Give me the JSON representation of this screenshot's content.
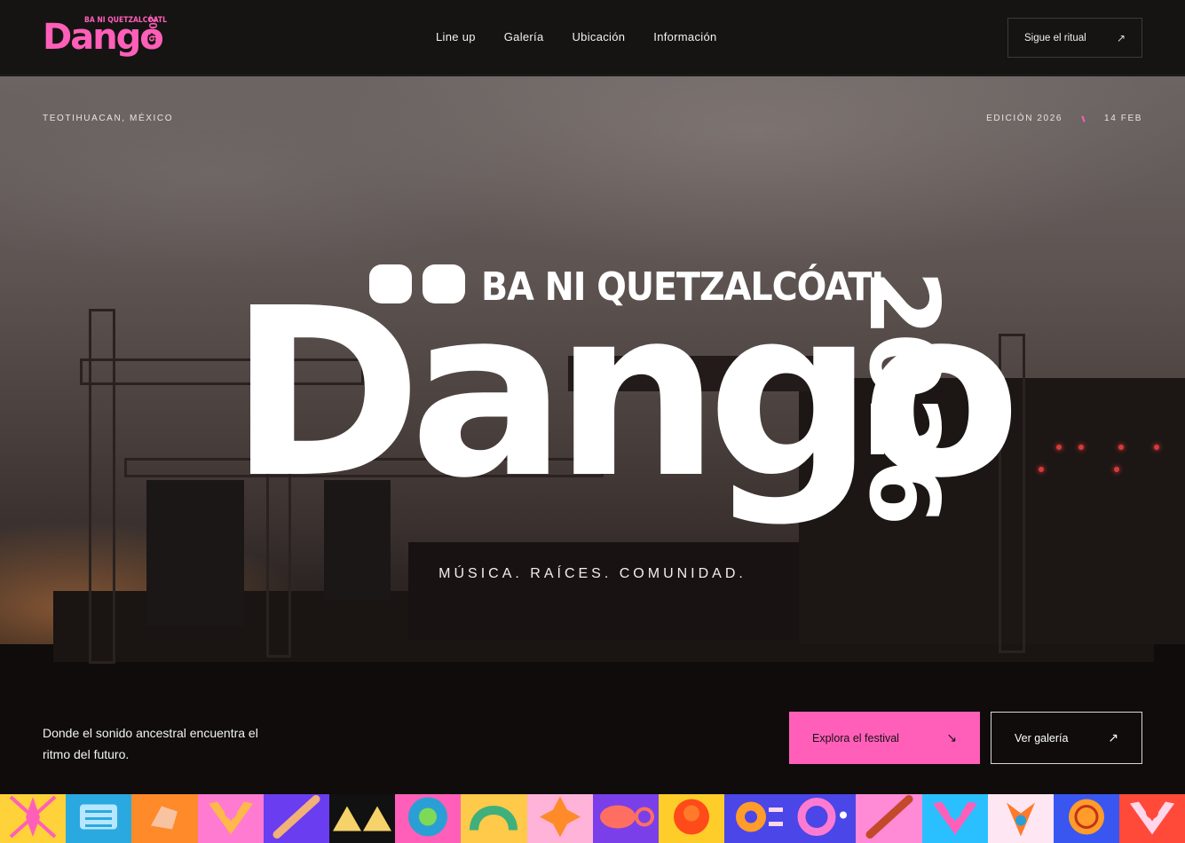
{
  "header": {
    "logo": {
      "main": "Dango",
      "sub": "BA NI QUETZALCÓATL",
      "year": "2026"
    },
    "nav": [
      {
        "label": "Line up"
      },
      {
        "label": "Galería"
      },
      {
        "label": "Ubicación"
      },
      {
        "label": "Información"
      }
    ],
    "follow_button": {
      "label": "Sigue el ritual",
      "icon": "arrow-up-right-icon"
    }
  },
  "hero": {
    "location": "TEOTIHUACAN, MÉXICO",
    "edition": "EDICIÓN 2026",
    "date": "14 FEB",
    "logo": {
      "main": "Dango",
      "sub": "BA NI QUETZALCÓATL",
      "year": "2026"
    },
    "tagline": "MÚSICA. RAÍCES. COMUNIDAD.",
    "blurb": "Donde el sonido ancestral encuentra el ritmo del futuro.",
    "primary_button": {
      "label": "Explora el festival",
      "icon": "arrow-down-right-icon"
    },
    "secondary_button": {
      "label": "Ver galería",
      "icon": "arrow-up-right-icon"
    }
  },
  "colors": {
    "accent": "#ff5fb8",
    "header_bg": "#151413"
  },
  "pattern_strip": [
    {
      "bg": "#ffd23a",
      "fg": "#ff5fb8",
      "icon": "feathered-figure-icon"
    },
    {
      "bg": "#2aa9e0",
      "fg": "#b7e6ff",
      "icon": "glyph-grid-icon"
    },
    {
      "bg": "#ff8a2a",
      "fg": "#f7c3a1",
      "icon": "stone-icon"
    },
    {
      "bg": "#ff7ad1",
      "fg": "#ffb84a",
      "icon": "headdress-icon"
    },
    {
      "bg": "#6a3df0",
      "fg": "#f1b178",
      "icon": "flute-icon"
    },
    {
      "bg": "#111111",
      "fg": "#f5d36a",
      "icon": "pyramid-icon"
    },
    {
      "bg": "#ff5fb8",
      "fg": "#2a9fd6",
      "icon": "sun-stone-icon"
    },
    {
      "bg": "#ffc94a",
      "fg": "#3fb07b",
      "icon": "serpent-icon"
    },
    {
      "bg": "#ffb3d9",
      "fg": "#ff8a2a",
      "icon": "star-diamond-icon"
    },
    {
      "bg": "#7a3fe8",
      "fg": "#ff6f61",
      "icon": "fish-icon"
    },
    {
      "bg": "#ffcd2a",
      "fg": "#ff4a1a",
      "icon": "sun-icon"
    },
    {
      "bg": "#4a46e8",
      "fg": "#ff9c2a",
      "icon": "eye-icon"
    },
    {
      "bg": "#4a46e8",
      "fg": "#ff7ad1",
      "icon": "ring-icon"
    },
    {
      "bg": "#ff8ad6",
      "fg": "#c24a2a",
      "icon": "flute-icon"
    },
    {
      "bg": "#2ac0ff",
      "fg": "#ff5fb8",
      "icon": "headdress-icon"
    },
    {
      "bg": "#ffe6f3",
      "fg": "#ff7a2a",
      "icon": "quetzal-icon"
    },
    {
      "bg": "#3a56f0",
      "fg": "#ff9c2a",
      "icon": "medallion-icon"
    },
    {
      "bg": "#ff4a3a",
      "fg": "#ffd6ea",
      "icon": "headdress-icon"
    }
  ]
}
